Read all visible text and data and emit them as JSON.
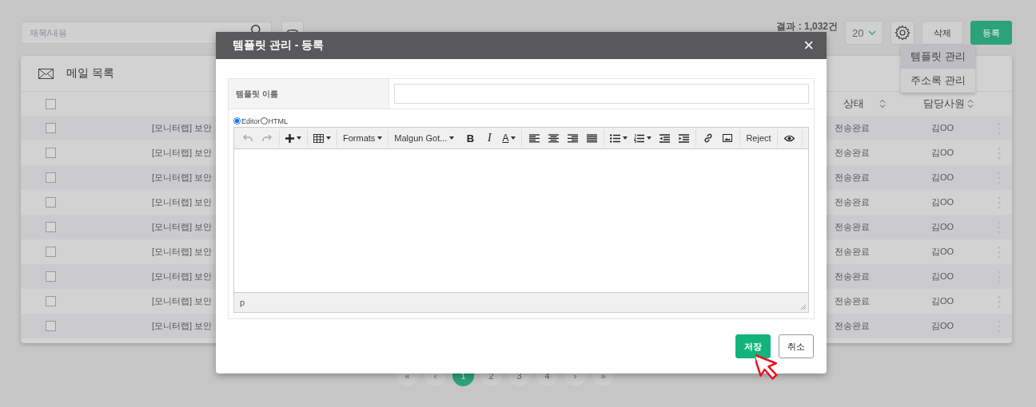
{
  "toolbar": {
    "search": {
      "placeholder": "재목/내용"
    },
    "result_count": "결과 : 1,032건",
    "page_size": "20",
    "buttons": [
      {
        "label": "삭제",
        "kind": "default"
      },
      {
        "label": "등록",
        "kind": "primary"
      }
    ],
    "settings_menu": {
      "open": true,
      "items": [
        {
          "label": "템플릿 관리",
          "selected": true
        },
        {
          "label": "주소록 관리",
          "selected": false
        }
      ]
    }
  },
  "mail_list": {
    "title": "메일 목록",
    "header_checked": false,
    "columns": [
      {
        "label": "상태",
        "sortable": true
      },
      {
        "label": "담당사원",
        "sortable": true
      }
    ],
    "rows": [
      {
        "checked": false,
        "title": "[모니터랩] 보안",
        "status": "전송완료",
        "owner": "김OO"
      },
      {
        "checked": false,
        "title": "[모니터랩] 보안",
        "status": "전송완료",
        "owner": "김OO"
      },
      {
        "checked": false,
        "title": "[모니터랩] 보안",
        "status": "전송완료",
        "owner": "김OO"
      },
      {
        "checked": false,
        "title": "[모니터랩] 보안",
        "status": "전송완료",
        "owner": "김OO"
      },
      {
        "checked": false,
        "title": "[모니터랩] 보안",
        "status": "전송완료",
        "owner": "김OO"
      },
      {
        "checked": false,
        "title": "[모니터랩] 보안",
        "status": "전송완료",
        "owner": "김OO"
      },
      {
        "checked": false,
        "title": "[모니터랩] 보안",
        "status": "전송완료",
        "owner": "김OO"
      },
      {
        "checked": false,
        "title": "[모니터랩] 보안",
        "status": "전송완료",
        "owner": "김OO"
      },
      {
        "checked": false,
        "title": "[모니터랩] 보안",
        "status": "전송완료",
        "owner": "김OO"
      }
    ]
  },
  "pagination": [
    {
      "label": "«",
      "selected": false
    },
    {
      "label": "‹",
      "selected": false
    },
    {
      "label": "1",
      "selected": true
    },
    {
      "label": "2",
      "selected": false
    },
    {
      "label": "3",
      "selected": false
    },
    {
      "label": "4",
      "selected": false
    },
    {
      "label": "›",
      "selected": false
    },
    {
      "label": "»",
      "selected": false
    }
  ],
  "modal": {
    "title": "템플릿 관리 - 등록",
    "close": "×",
    "name_label": "템플릿 이름",
    "mode_options": [
      {
        "label": "Editor",
        "selected": true
      },
      {
        "label": "HTML",
        "selected": false
      }
    ],
    "editor": {
      "undo": {
        "disabled": true
      },
      "redo": {
        "disabled": true
      },
      "formats": "Formats",
      "font": "Malgun Got...",
      "bold": "B",
      "italic": "I",
      "text_color": "A",
      "reject": "Reject",
      "status_path": "p"
    },
    "buttons": [
      {
        "label": "저장",
        "kind": "primary"
      },
      {
        "label": "취소",
        "kind": "default"
      }
    ]
  }
}
